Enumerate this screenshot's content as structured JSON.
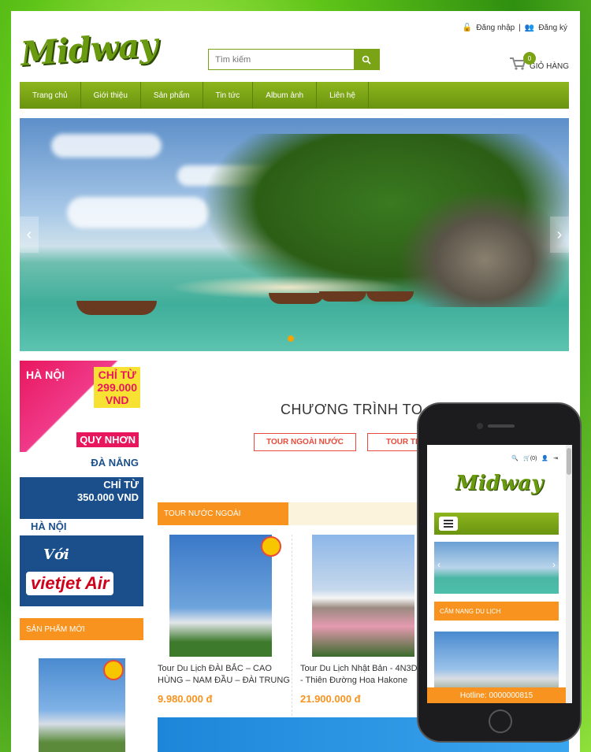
{
  "header": {
    "logo": "Midway",
    "search_placeholder": "Tìm kiếm",
    "login": "Đăng nhập",
    "separator": "|",
    "register": "Đăng ký",
    "cart_count": "0",
    "cart_label": "GIỎ HÀNG"
  },
  "nav": [
    "Trang chủ",
    "Giới thiệu",
    "Sản phẩm",
    "Tin tức",
    "Album ảnh",
    "Liên hệ"
  ],
  "slider": {
    "active_slide": 1
  },
  "sidebar": {
    "banner1": {
      "city": "HÀ NỘI",
      "price_line1": "CHỈ TỪ",
      "price_line2": "299.000",
      "price_line3": "VND",
      "destination": "QUY NHƠN"
    },
    "banner2": {
      "city1": "ĐÀ NẴNG",
      "price_line1": "CHỈ TỪ",
      "price_line2": "350.000 VND",
      "city2": "HÀ NỘI"
    },
    "banner3": {
      "with": "Với",
      "brand": "vietjet Air"
    },
    "new_products_title": "SẢN PHẨM MỚI"
  },
  "main": {
    "title": "CHƯƠNG TRÌNH TO",
    "tour_buttons": [
      "TOUR NGOÀI NƯỚC",
      "TOUR TRO"
    ],
    "tab_label": "TOUR NƯỚC NGOÀI",
    "cards": [
      {
        "title": "Tour Du Lịch ĐÀI BẮC – CAO HÙNG – NAM ĐẦU – ĐÀI TRUNG",
        "price": "9.980.000 đ"
      },
      {
        "title": "Tour Du Lịch Nhật Bản - 4N3D - Thiên Đường Hoa Hakone",
        "price": "21.900.000 đ"
      }
    ]
  },
  "mobile": {
    "cart_text": "(0)",
    "logo": "Midway",
    "section_title": "CẨM NANG DU LỊCH",
    "hotline": "Hotline: 0000000815"
  },
  "colors": {
    "brand_green": "#7aa316",
    "accent_orange": "#f7931e",
    "tour_red": "#e84b3a"
  }
}
